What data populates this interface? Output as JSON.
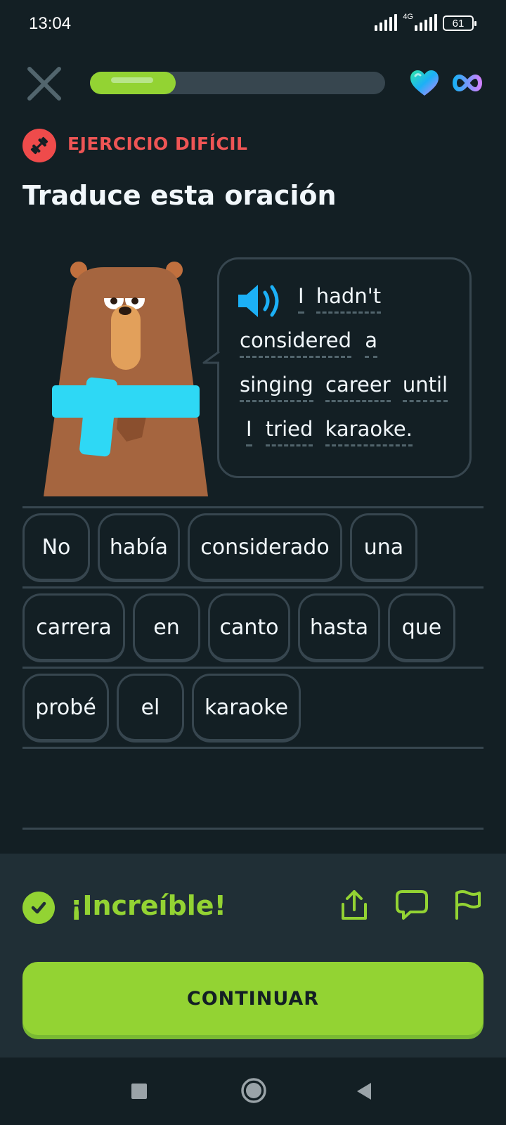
{
  "status": {
    "time": "13:04",
    "network": "4G",
    "battery": "61"
  },
  "progress": {
    "fraction": 0.29
  },
  "exercise": {
    "badge_label": "EJERCICIO DIFÍCIL",
    "title": "Traduce esta oración",
    "sentence_lines": [
      [
        "I",
        "hadn't"
      ],
      [
        "considered",
        "a"
      ],
      [
        "singing",
        "career",
        "until"
      ],
      [
        "I",
        "tried",
        "karaoke."
      ]
    ]
  },
  "answer_words": [
    [
      "No",
      "había",
      "considerado",
      "una"
    ],
    [
      "carrera",
      "en",
      "canto",
      "hasta",
      "que"
    ],
    [
      "probé",
      "el",
      "karaoke"
    ]
  ],
  "feedback": {
    "message": "¡Increíble!",
    "continue_label": "CONTINUAR"
  },
  "icons": {
    "close": "close-icon",
    "hearts": "heart-icon",
    "infinity": "infinity-icon",
    "speaker": "speaker-icon",
    "share": "share-icon",
    "comment": "comment-icon",
    "flag": "flag-icon"
  },
  "colors": {
    "accent": "#93d333",
    "hard": "#ef4b4b",
    "speaker": "#1cb0f6",
    "background": "#131f24"
  }
}
